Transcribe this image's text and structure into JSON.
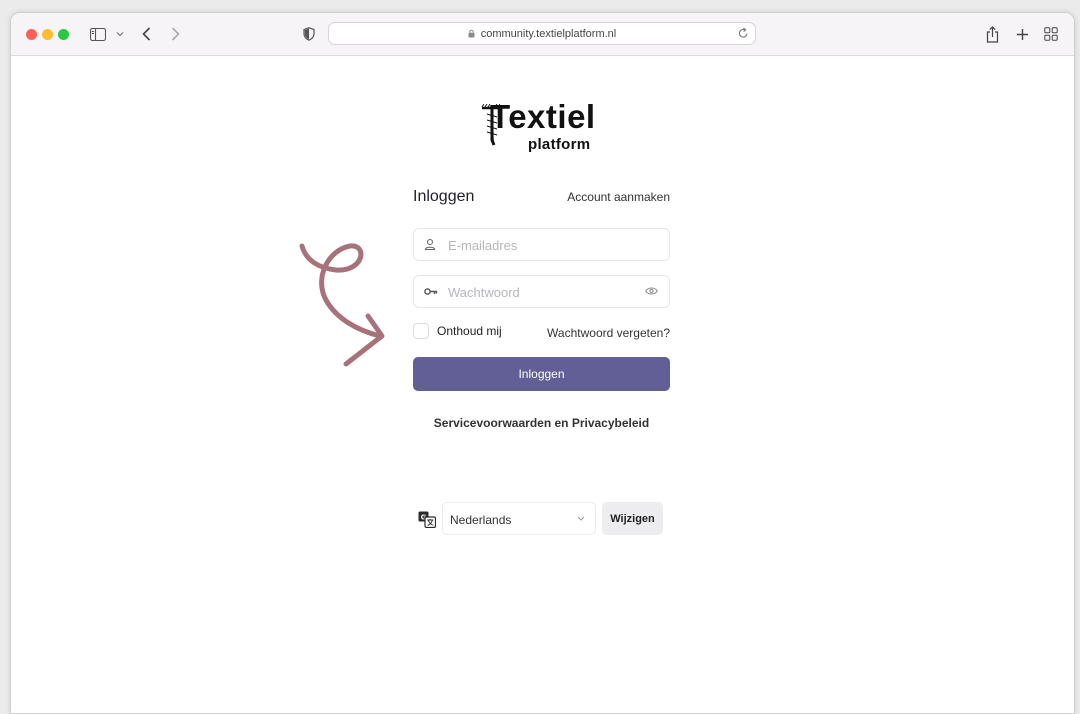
{
  "browser": {
    "url": "community.textielplatform.nl"
  },
  "logo": {
    "main": "Textiel",
    "sub": "platform"
  },
  "login": {
    "title": "Inloggen",
    "create_account": "Account aanmaken",
    "email_placeholder": "E-mailadres",
    "password_placeholder": "Wachtwoord",
    "remember_label": "Onthoud mij",
    "remember_checked": false,
    "forgot_password": "Wachtwoord vergeten?",
    "submit_label": "Inloggen",
    "terms_link": "Servicevoorwaarden en Privacybeleid"
  },
  "language": {
    "selected": "Nederlands",
    "change_label": "Wijzigen"
  },
  "colors": {
    "primary_button": "#615f96",
    "annotation_arrow": "#a8727d"
  },
  "icons": {
    "email": "user-icon",
    "password": "key-icon",
    "show_password": "eye-icon",
    "language": "translate-icon",
    "annotation": "curly-arrow-icon"
  }
}
